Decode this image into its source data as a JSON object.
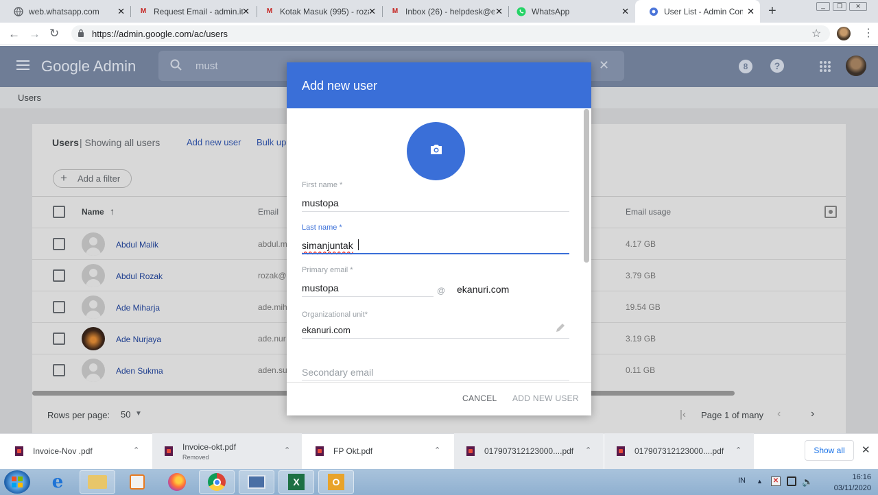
{
  "browser": {
    "tabs": [
      {
        "title": "web.whatsapp.com",
        "icon": "globe-icon"
      },
      {
        "title": "Request Email - admin.it",
        "icon": "gmail-icon"
      },
      {
        "title": "Kotak Masuk (995) - roza",
        "icon": "gmail-icon"
      },
      {
        "title": "Inbox (26) - helpdesk@e",
        "icon": "gmail-icon"
      },
      {
        "title": "WhatsApp",
        "icon": "whatsapp-icon"
      },
      {
        "title": "User List - Admin Conso",
        "icon": "admin-gear-icon"
      }
    ],
    "url": "https://admin.google.com/ac/users"
  },
  "app": {
    "logo": "Google Admin",
    "search_value": "must",
    "badge": "8",
    "breadcrumb": "Users"
  },
  "users_panel": {
    "title": "Users",
    "subtitle": "| Showing all users",
    "add_new_user": "Add new user",
    "bulk_upload": "Bulk up",
    "add_filter": "Add a filter",
    "columns": {
      "name": "Name",
      "email": "Email",
      "usage": "Email usage"
    },
    "rows": [
      {
        "name": "Abdul Malik",
        "email": "abdul.m",
        "usage": "4.17 GB"
      },
      {
        "name": "Abdul Rozak",
        "email": "rozak@",
        "usage": "3.79 GB"
      },
      {
        "name": "Ade Miharja",
        "email": "ade.mih",
        "usage": "19.54 GB"
      },
      {
        "name": "Ade Nurjaya",
        "email": "ade.nur",
        "usage": "3.19 GB"
      },
      {
        "name": "Aden Sukma",
        "email": "aden.su",
        "usage": "0.11 GB"
      }
    ],
    "rows_per_page_label": "Rows per page:",
    "rows_per_page": "50",
    "pagination": "Page 1 of many"
  },
  "dialog": {
    "title": "Add new user",
    "first_name_label": "First name *",
    "first_name": "mustopa",
    "last_name_label": "Last name *",
    "last_name": "simanjuntak",
    "primary_email_label": "Primary email *",
    "primary_email": "mustopa",
    "at": "@",
    "domain": "ekanuri.com",
    "org_unit_label": "Organizational unit*",
    "org_unit": "ekanuri.com",
    "secondary_email_placeholder": "Secondary email",
    "cancel": "CANCEL",
    "submit": "ADD NEW USER"
  },
  "downloads": {
    "items": [
      {
        "name": "Invoice-Nov .pdf",
        "status": ""
      },
      {
        "name": "Invoice-okt.pdf",
        "status": "Removed"
      },
      {
        "name": "FP Okt.pdf",
        "status": ""
      },
      {
        "name": "017907312123000....pdf",
        "status": ""
      },
      {
        "name": "017907312123000....pdf",
        "status": ""
      }
    ],
    "show_all": "Show all"
  },
  "taskbar": {
    "lang": "IN",
    "time": "16:16",
    "date": "03/11/2020"
  },
  "colors": {
    "header": "#6f7d96",
    "dialog_header": "#3a6fd8",
    "link": "#1f3f8f"
  }
}
